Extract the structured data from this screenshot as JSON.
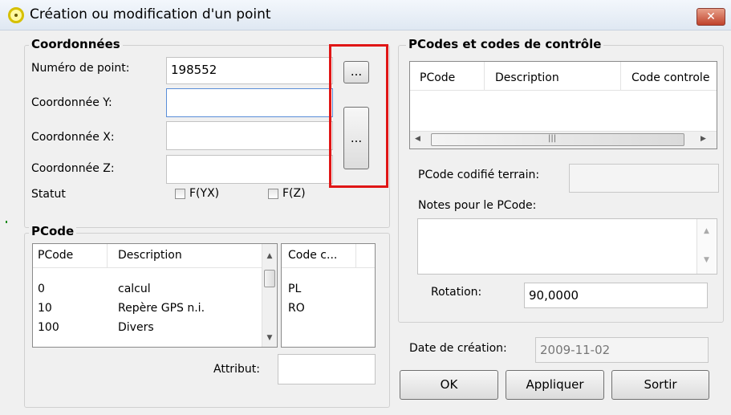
{
  "window": {
    "title": "Création ou modification d'un point",
    "close_label": "✕"
  },
  "coordinates": {
    "legend": "Coordonnées",
    "point_number_label": "Numéro de point:",
    "point_number_value": "198552",
    "coord_y_label": "Coordonnée Y:",
    "coord_y_value": "",
    "coord_x_label": "Coordonnée X:",
    "coord_x_value": "",
    "coord_z_label": "Coordonnée Z:",
    "coord_z_value": "",
    "status_label": "Statut",
    "fyx_label": "F(YX)",
    "fz_label": "F(Z)",
    "browse_small_label": "...",
    "browse_large_label": "..."
  },
  "pcode": {
    "legend": "PCode",
    "columns": [
      "PCode",
      "Description"
    ],
    "rows": [
      {
        "code": "0",
        "description": "calcul"
      },
      {
        "code": "10",
        "description": "Repère GPS n.i."
      },
      {
        "code": "100",
        "description": "Divers"
      }
    ],
    "control_column": "Code c...",
    "control_rows": [
      "PL",
      "RO"
    ],
    "attribute_label": "Attribut:",
    "attribute_value": ""
  },
  "pcodes_controle": {
    "legend": "PCodes et codes de contrôle",
    "columns": [
      "PCode",
      "Description",
      "Code controle"
    ],
    "field_pcode_label": "PCode codifié terrain:",
    "field_pcode_value": "",
    "notes_label": "Notes pour le PCode:",
    "notes_value": "",
    "rotation_label": "Rotation:",
    "rotation_value": "90,0000"
  },
  "creation": {
    "date_label": "Date de création:",
    "date_value": "2009-11-02"
  },
  "buttons": {
    "ok": "OK",
    "apply": "Appliquer",
    "exit": "Sortir"
  },
  "scroll_glyphs": {
    "up": "▲",
    "down": "▼",
    "left": "◀",
    "right": "▶",
    "grip": "|||"
  },
  "colors": {
    "highlight_box": "#e01616",
    "dialog_bg": "#f0f0f0",
    "field_focus": "#5a8ed8"
  }
}
